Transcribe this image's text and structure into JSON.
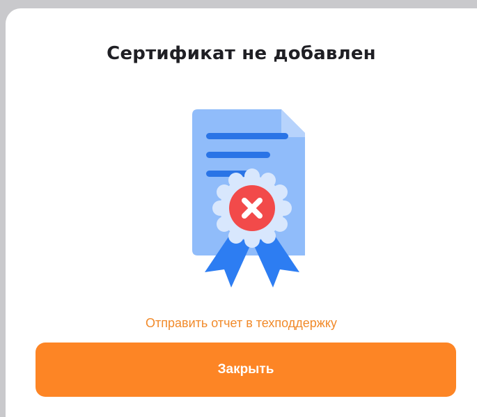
{
  "dialog": {
    "title": "Сертификат не добавлен",
    "illustration_icon": "certificate-error-icon",
    "report_link_label": "Отправить отчет в техподдержку",
    "close_button_label": "Закрыть"
  },
  "colors": {
    "accent": "#fd8525",
    "link": "#f18a2a",
    "title": "#1f1f24",
    "document": "#90bcfa",
    "document_lines": "#2a74e6",
    "seal": "#d8e7fd",
    "ribbon": "#2d7df2",
    "error": "#f24a4a"
  }
}
